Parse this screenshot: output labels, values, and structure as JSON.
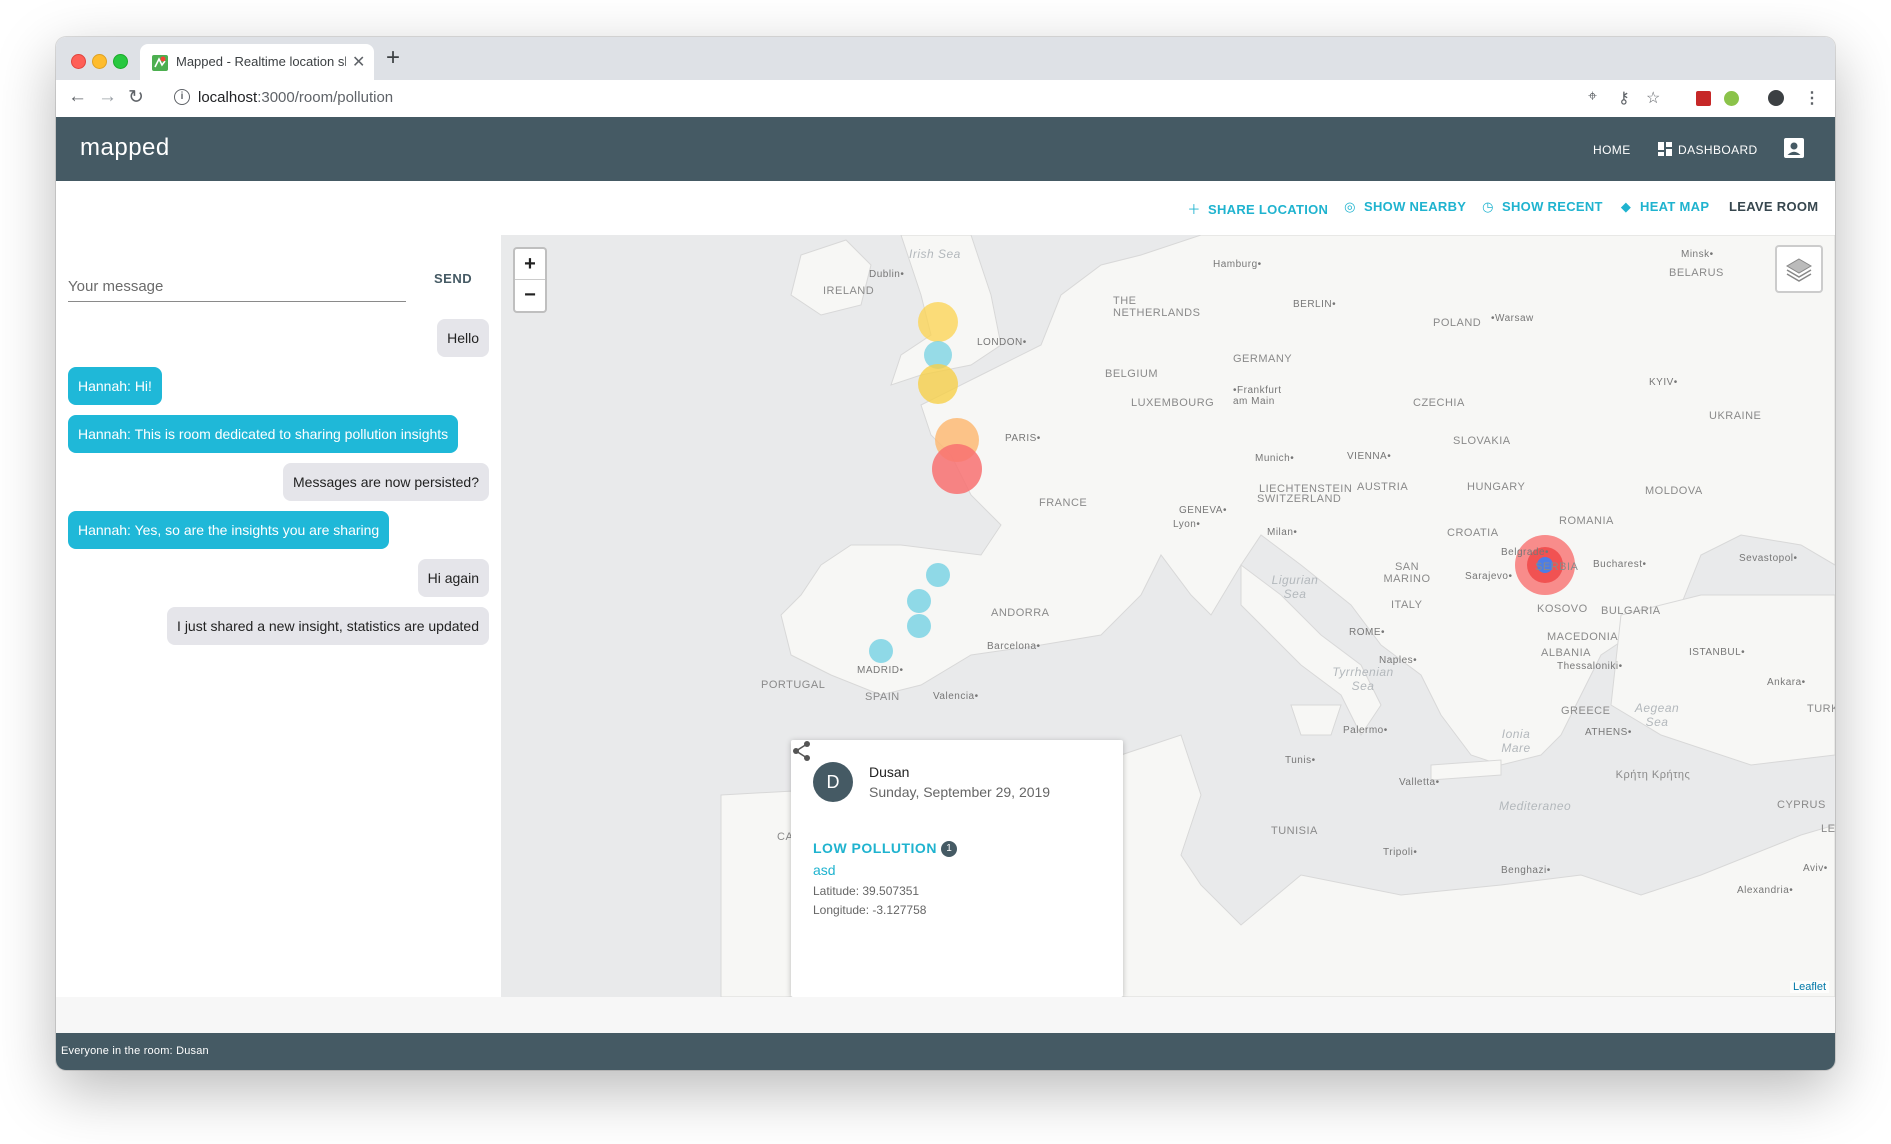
{
  "browser": {
    "tab_title": "Mapped - Realtime location sh",
    "tab_close": "✕",
    "new_tab": "+",
    "url_host": "localhost",
    "url_path": ":3000/room/pollution"
  },
  "appbar": {
    "brand": "mapped",
    "home": "HOME",
    "dashboard": "DASHBOARD"
  },
  "actions": {
    "share_location": "SHARE LOCATION",
    "show_nearby": "SHOW NEARBY",
    "show_recent": "SHOW RECENT",
    "heat_map": "HEAT MAP",
    "leave_room": "LEAVE ROOM"
  },
  "chat": {
    "placeholder": "Your message",
    "send_label": "SEND",
    "messages": [
      {
        "from": "me",
        "text": "Hello"
      },
      {
        "from": "them",
        "text": "Hannah: Hi!"
      },
      {
        "from": "them",
        "text": "Hannah: This is room dedicated to sharing pollution insights"
      },
      {
        "from": "me",
        "text": "Messages are now persisted?"
      },
      {
        "from": "them",
        "text": "Hannah: Yes, so are the insights you are sharing"
      },
      {
        "from": "me",
        "text": "Hi again"
      },
      {
        "from": "me",
        "text": "I just shared a new insight, statistics are updated"
      }
    ]
  },
  "map": {
    "zoom_in": "+",
    "zoom_out": "−",
    "attribution": "Leaflet",
    "labels": {
      "irish_sea": "Irish Sea",
      "dublin": "Dublin•",
      "ireland": "IRELAND",
      "london": "LONDON•",
      "netherlands": "THE NETHERLANDS",
      "hamburg": "Hamburg•",
      "berlin": "BERLIN•",
      "poland": "POLAND",
      "warsaw": "•Warsaw",
      "minsk": "Minsk•",
      "belarus": "BELARUS",
      "belgium": "BELGIUM",
      "germany": "GERMANY",
      "luxembourg": "LUXEMBOURG",
      "frankfurt": "•Frankfurt am Main",
      "czechia": "CZECHIA",
      "kyiv": "KYIV•",
      "ukraine": "UKRAINE",
      "paris": "PARIS•",
      "munich": "Munich•",
      "vienna": "VIENNA•",
      "slovakia": "SLOVAKIA",
      "moldova": "MOLDOVA",
      "liechtenstein": "LIECHTENSTEIN",
      "austria": "AUSTRIA",
      "hungary": "HUNGARY",
      "switzerland": "SWITZERLAND",
      "france": "FRANCE",
      "geneva": "GENEVA•",
      "lyon": "Lyon•",
      "milan": "Milan•",
      "romania": "ROMANIA",
      "croatia": "CROATIA",
      "belgrade": "Belgrade•",
      "serbia": "SERBIA",
      "bucharest": "Bucharest•",
      "sevastopol": "Sevastopol•",
      "ligurian_sea": "Ligurian Sea",
      "san_marino": "SAN MARINO",
      "sarajevo": "Sarajevo•",
      "italy": "ITALY",
      "andorra": "ANDORRA",
      "kosovo": "KOSOVO",
      "bulgaria": "BULGARIA",
      "rome": "ROME•",
      "macedonia": "MACEDONIA",
      "barcelona": "Barcelona•",
      "albania": "ALBANIA",
      "thessaloniki": "Thessaloniki•",
      "istanbul": "ISTANBUL•",
      "madrid": "MADRID•",
      "naples": "Naples•",
      "portugal": "PORTUGAL",
      "spain": "SPAIN",
      "valencia": "Valencia•",
      "tyrrhenian": "Tyrrhenian Sea",
      "ankara": "Ankara•",
      "greece": "GREECE",
      "aegean": "Aegean Sea",
      "turk": "TURK",
      "palermo": "Palermo•",
      "athens": "ATHENS•",
      "ionian": "Ionia Mare",
      "tunis": "Tunis•",
      "kriti": "Κρήτη Κρήτης",
      "valletta": "Valletta•",
      "mediterranean": "Mediteraneo",
      "cyprus": "CYPRUS",
      "tunisia": "TUNISIA",
      "tripoli": "Tripoli•",
      "benghazi": "Benghazi•",
      "alexandria": "Alexandria•",
      "le": "LE",
      "aviv": "Aviv•",
      "ca": "CA"
    }
  },
  "popup": {
    "avatar_letter": "D",
    "name": "Dusan",
    "date": "Sunday, September 29, 2019",
    "level": "LOW POLLUTION",
    "badge": "1",
    "note": "asd",
    "latitude": "Latitude: 39.507351",
    "longitude": "Longitude: -3.127758"
  },
  "footer": {
    "text": "Everyone in the room:  Dusan"
  },
  "colors": {
    "appbar": "#455a64",
    "accent": "#1fb3cf",
    "bubble_them": "#1fb8d8",
    "bubble_me": "#e5e5ea"
  }
}
